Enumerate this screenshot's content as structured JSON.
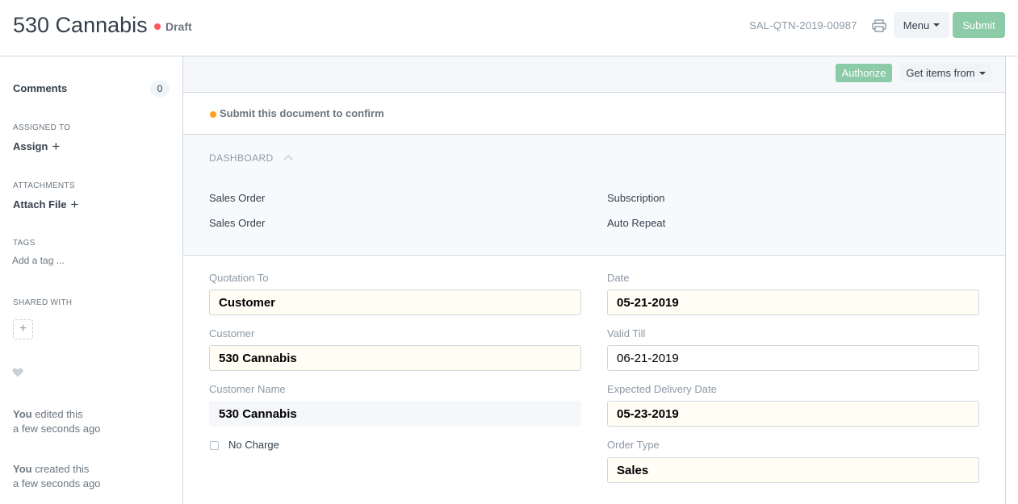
{
  "header": {
    "title": "530 Cannabis",
    "status": "Draft",
    "doc_name": "SAL-QTN-2019-00987",
    "menu_label": "Menu",
    "submit_label": "Submit",
    "status_color": "#ff5858",
    "primary_color": "#8ccba7"
  },
  "sidebar": {
    "comments_label": "Comments",
    "comments_count": "0",
    "assigned_to_label": "ASSIGNED TO",
    "assign_label": "Assign",
    "attachments_label": "ATTACHMENTS",
    "attach_label": "Attach File",
    "tags_label": "TAGS",
    "tag_placeholder": "Add a tag ...",
    "shared_with_label": "SHARED WITH",
    "shared_add": "+",
    "activity": [
      {
        "who": "You",
        "action": " edited this",
        "when": "a few seconds ago"
      },
      {
        "who": "You",
        "action": " created this",
        "when": "a few seconds ago"
      }
    ]
  },
  "actions": {
    "authorize_label": "Authorize",
    "get_items_label": "Get items from"
  },
  "notice": {
    "text": "Submit this document to confirm",
    "dot_color": "#ff9f1c"
  },
  "dashboard": {
    "heading": "DASHBOARD",
    "groups": [
      {
        "title": "Sales Order",
        "link": "Sales Order"
      },
      {
        "title": "Subscription",
        "link": "Auto Repeat"
      }
    ]
  },
  "form": {
    "quotation_to": {
      "label": "Quotation To",
      "value": "Customer"
    },
    "customer": {
      "label": "Customer",
      "value": "530 Cannabis"
    },
    "customer_name": {
      "label": "Customer Name",
      "value": "530 Cannabis"
    },
    "no_charge": {
      "label": "No Charge",
      "checked": false
    },
    "date": {
      "label": "Date",
      "value": "05-21-2019"
    },
    "valid_till": {
      "label": "Valid Till",
      "value": "06-21-2019"
    },
    "expected_delivery_date": {
      "label": "Expected Delivery Date",
      "value": "05-23-2019"
    },
    "order_type": {
      "label": "Order Type",
      "value": "Sales"
    }
  },
  "icons": [
    "printer-icon",
    "caret-down-icon",
    "plus-icon",
    "heart-icon",
    "chevron-up-icon"
  ]
}
